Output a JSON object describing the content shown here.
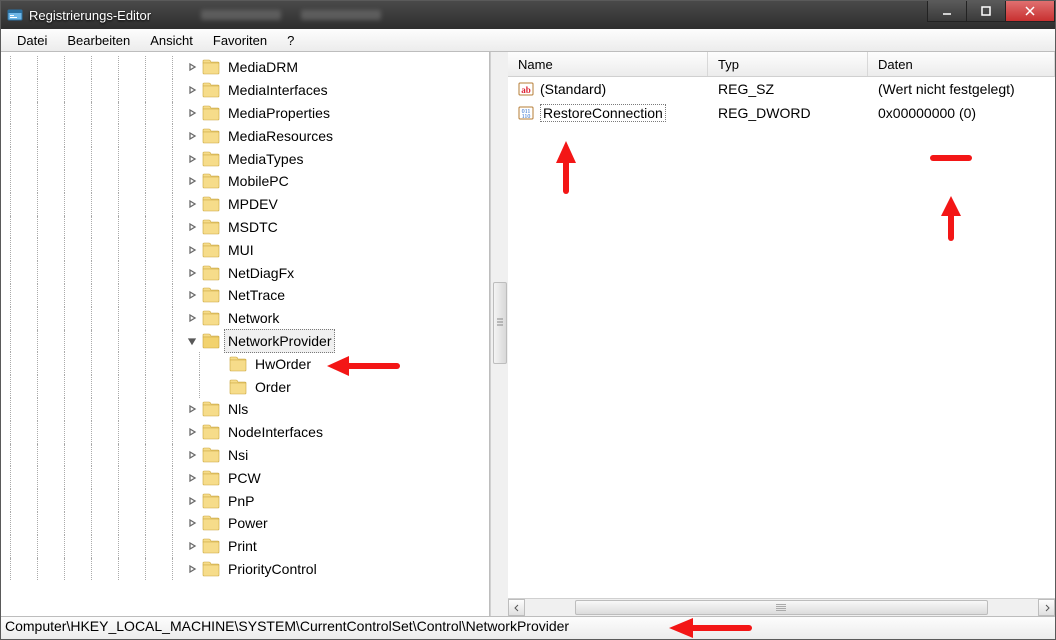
{
  "window": {
    "title": "Registrierungs-Editor"
  },
  "menubar": {
    "items": [
      "Datei",
      "Bearbeiten",
      "Ansicht",
      "Favoriten",
      "?"
    ]
  },
  "tree": {
    "selected": "NetworkProvider",
    "items": [
      {
        "label": "MediaDRM",
        "depth": 7,
        "expandable": true,
        "open": false
      },
      {
        "label": "MediaInterfaces",
        "depth": 7,
        "expandable": true,
        "open": false
      },
      {
        "label": "MediaProperties",
        "depth": 7,
        "expandable": true,
        "open": false
      },
      {
        "label": "MediaResources",
        "depth": 7,
        "expandable": true,
        "open": false
      },
      {
        "label": "MediaTypes",
        "depth": 7,
        "expandable": true,
        "open": false
      },
      {
        "label": "MobilePC",
        "depth": 7,
        "expandable": true,
        "open": false
      },
      {
        "label": "MPDEV",
        "depth": 7,
        "expandable": true,
        "open": false
      },
      {
        "label": "MSDTC",
        "depth": 7,
        "expandable": true,
        "open": false
      },
      {
        "label": "MUI",
        "depth": 7,
        "expandable": true,
        "open": false
      },
      {
        "label": "NetDiagFx",
        "depth": 7,
        "expandable": true,
        "open": false
      },
      {
        "label": "NetTrace",
        "depth": 7,
        "expandable": true,
        "open": false
      },
      {
        "label": "Network",
        "depth": 7,
        "expandable": true,
        "open": false
      },
      {
        "label": "NetworkProvider",
        "depth": 7,
        "expandable": true,
        "open": true,
        "selected": true
      },
      {
        "label": "HwOrder",
        "depth": 8,
        "expandable": false,
        "open": false
      },
      {
        "label": "Order",
        "depth": 8,
        "expandable": false,
        "open": false
      },
      {
        "label": "Nls",
        "depth": 7,
        "expandable": true,
        "open": false
      },
      {
        "label": "NodeInterfaces",
        "depth": 7,
        "expandable": true,
        "open": false
      },
      {
        "label": "Nsi",
        "depth": 7,
        "expandable": true,
        "open": false
      },
      {
        "label": "PCW",
        "depth": 7,
        "expandable": true,
        "open": false
      },
      {
        "label": "PnP",
        "depth": 7,
        "expandable": true,
        "open": false
      },
      {
        "label": "Power",
        "depth": 7,
        "expandable": true,
        "open": false
      },
      {
        "label": "Print",
        "depth": 7,
        "expandable": true,
        "open": false
      },
      {
        "label": "PriorityControl",
        "depth": 7,
        "expandable": true,
        "open": false
      }
    ]
  },
  "list": {
    "columns": {
      "name": "Name",
      "type": "Typ",
      "data": "Daten"
    },
    "rows": [
      {
        "icon": "string",
        "name": "(Standard)",
        "type": "REG_SZ",
        "data": "(Wert nicht festgelegt)",
        "selected": false
      },
      {
        "icon": "dword",
        "name": "RestoreConnection",
        "type": "REG_DWORD",
        "data": "0x00000000 (0)",
        "selected": true
      }
    ]
  },
  "statusbar": {
    "path": "Computer\\HKEY_LOCAL_MACHINE\\SYSTEM\\CurrentControlSet\\Control\\NetworkProvider"
  }
}
